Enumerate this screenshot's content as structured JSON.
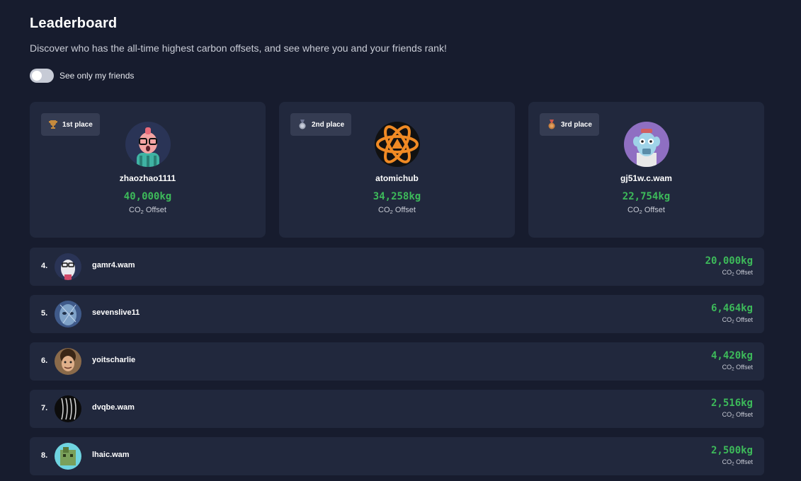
{
  "header": {
    "title": "Leaderboard",
    "subtitle": "Discover who has the all-time highest carbon offsets, and see where you and your friends rank!"
  },
  "friends_toggle": {
    "label": "See only my friends",
    "checked": false
  },
  "offset_label": {
    "prefix": "CO",
    "subscript": "2",
    "suffix": " Offset"
  },
  "podium": [
    {
      "place_label": "1st place",
      "place_icon": "trophy-icon",
      "name": "zhaozhao1111",
      "amount": "40,000kg"
    },
    {
      "place_label": "2nd place",
      "place_icon": "silver-medal-icon",
      "name": "atomichub",
      "amount": "34,258kg"
    },
    {
      "place_label": "3rd place",
      "place_icon": "bronze-medal-icon",
      "name": "gj51w.c.wam",
      "amount": "22,754kg"
    }
  ],
  "rows": [
    {
      "rank": "4.",
      "name": "gamr4.wam",
      "amount": "20,000kg"
    },
    {
      "rank": "5.",
      "name": "sevenslive11",
      "amount": "6,464kg"
    },
    {
      "rank": "6.",
      "name": "yoitscharlie",
      "amount": "4,420kg"
    },
    {
      "rank": "7.",
      "name": "dvqbe.wam",
      "amount": "2,516kg"
    },
    {
      "rank": "8.",
      "name": "lhaic.wam",
      "amount": "2,500kg"
    }
  ],
  "colors": {
    "background": "#171c2e",
    "card": "#21283d",
    "accent_green": "#3dba5a"
  }
}
